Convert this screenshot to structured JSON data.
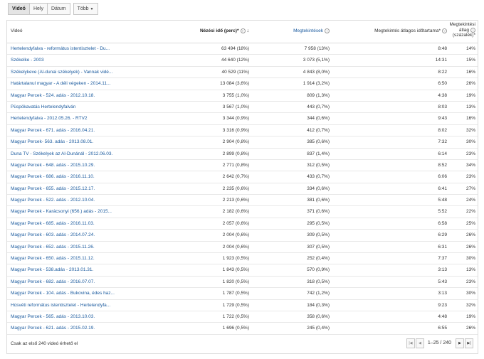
{
  "tabs": [
    {
      "label": "Videó",
      "active": true
    },
    {
      "label": "Hely",
      "active": false
    },
    {
      "label": "Dátum",
      "active": false
    },
    {
      "label": "Több",
      "active": false
    }
  ],
  "columns": {
    "video": "Videó",
    "watch_time": "Nézési idő (perc)*",
    "views": "Megtekintések",
    "avg_duration": "Megtekintés átlagos időtartama*",
    "avg_pct_line1": "Megtekintési",
    "avg_pct_line2": "átlag",
    "avg_pct_line3": "(százalék)*"
  },
  "rows": [
    {
      "title": "Hertelendyfalva - református istentisztelet - Du...",
      "watch": "63 494 (18%)",
      "views": "7 958 (13%)",
      "avg": "8:48",
      "pct": "14%"
    },
    {
      "title": "Székelke - 2003",
      "watch": "44 640 (12%)",
      "views": "3 073 (5,1%)",
      "avg": "14:31",
      "pct": "15%"
    },
    {
      "title": "Székelykeve (Al-dunai székelyek) - Vannak vidé...",
      "watch": "40 529 (11%)",
      "views": "4 843 (8,0%)",
      "avg": "8:22",
      "pct": "16%"
    },
    {
      "title": "Határtalanul magyar - A déli végeken - 2014.11...",
      "watch": "13 084 (3,6%)",
      "views": "1 914 (3,2%)",
      "avg": "6:50",
      "pct": "26%"
    },
    {
      "title": "Magyar Percek - 524. adás - 2012.10.18.",
      "watch": "3 755 (1,0%)",
      "views": "809 (1,3%)",
      "avg": "4:38",
      "pct": "19%"
    },
    {
      "title": "Püspökavatás Hertelendyfalván",
      "watch": "3 567 (1,0%)",
      "views": "443 (0,7%)",
      "avg": "8:03",
      "pct": "13%"
    },
    {
      "title": "Hertelendyfalva - 2012.05.26. - RTV2",
      "watch": "3 344 (0,9%)",
      "views": "344 (0,6%)",
      "avg": "9:43",
      "pct": "16%"
    },
    {
      "title": "Magyar Percek - 671. adás - 2016.04.21.",
      "watch": "3 316 (0,9%)",
      "views": "412 (0,7%)",
      "avg": "8:02",
      "pct": "32%"
    },
    {
      "title": "Magyar Percek- 563. adás - 2013.08.01.",
      "watch": "2 904 (0,8%)",
      "views": "385 (0,6%)",
      "avg": "7:32",
      "pct": "30%"
    },
    {
      "title": "Duna TV - Székelyek az Al-Dunánál - 2012.06.03.",
      "watch": "2 899 (0,8%)",
      "views": "837 (1,4%)",
      "avg": "6:14",
      "pct": "23%"
    },
    {
      "title": "Magyar Percek - 648. adás - 2015.10.29.",
      "watch": "2 771 (0,8%)",
      "views": "312 (0,5%)",
      "avg": "8:52",
      "pct": "34%"
    },
    {
      "title": "Magyar Percek - 686. adás - 2016.11.10.",
      "watch": "2 642 (0,7%)",
      "views": "433 (0,7%)",
      "avg": "6:06",
      "pct": "23%"
    },
    {
      "title": "Magyar Percek - 655. adás - 2015.12.17.",
      "watch": "2 235 (0,6%)",
      "views": "334 (0,6%)",
      "avg": "6:41",
      "pct": "27%"
    },
    {
      "title": "Magyar Percek - 522. adás - 2012.10.04.",
      "watch": "2 213 (0,6%)",
      "views": "381 (0,6%)",
      "avg": "5:48",
      "pct": "24%"
    },
    {
      "title": "Magyar Percek - Karácsonyi (656.) adás - 2015...",
      "watch": "2 182 (0,6%)",
      "views": "371 (0,6%)",
      "avg": "5:52",
      "pct": "22%"
    },
    {
      "title": "Magyar Percek - 685. adás - 2016.11.03.",
      "watch": "2 057 (0,6%)",
      "views": "295 (0,5%)",
      "avg": "6:58",
      "pct": "25%"
    },
    {
      "title": "Magyar Percek - 603. adás - 2014.07.24.",
      "watch": "2 004 (0,6%)",
      "views": "309 (0,5%)",
      "avg": "6:29",
      "pct": "26%"
    },
    {
      "title": "Magyar Percek - 652. adás - 2015.11.26.",
      "watch": "2 004 (0,6%)",
      "views": "307 (0,5%)",
      "avg": "6:31",
      "pct": "26%"
    },
    {
      "title": "Magyar Percek - 650. adás - 2015.11.12.",
      "watch": "1 923 (0,5%)",
      "views": "252 (0,4%)",
      "avg": "7:37",
      "pct": "30%"
    },
    {
      "title": "Magyar Percek - 538.adás - 2013.01.31.",
      "watch": "1 843 (0,5%)",
      "views": "570 (0,9%)",
      "avg": "3:13",
      "pct": "13%"
    },
    {
      "title": "Magyar Percek - 682. adás - 2016.07.07.",
      "watch": "1 820 (0,5%)",
      "views": "318 (0,5%)",
      "avg": "5:43",
      "pct": "23%"
    },
    {
      "title": "Magyar Percek - 104. adás - Bukovina, édes haz...",
      "watch": "1 787 (0,5%)",
      "views": "742 (1,2%)",
      "avg": "3:13",
      "pct": "30%"
    },
    {
      "title": "Húsvéti református istentisztelet - Hertelendyfa...",
      "watch": "1 729 (0,5%)",
      "views": "184 (0,3%)",
      "avg": "9:23",
      "pct": "32%"
    },
    {
      "title": "Magyar Percek - 565. adás - 2013.10.03.",
      "watch": "1 722 (0,5%)",
      "views": "358 (0,6%)",
      "avg": "4:48",
      "pct": "19%"
    },
    {
      "title": "Magyar Percek - 621. adás - 2015.02.19.",
      "watch": "1 696 (0,5%)",
      "views": "245 (0,4%)",
      "avg": "6:55",
      "pct": "26%"
    }
  ],
  "footer": {
    "note": "Csak az első 240 videó érhető el",
    "range": "1–25 / 240"
  },
  "icons": {
    "help": "?",
    "sort_down": "↓",
    "first": "|◀",
    "prev": "◀",
    "next": "▶",
    "last": "▶|"
  }
}
